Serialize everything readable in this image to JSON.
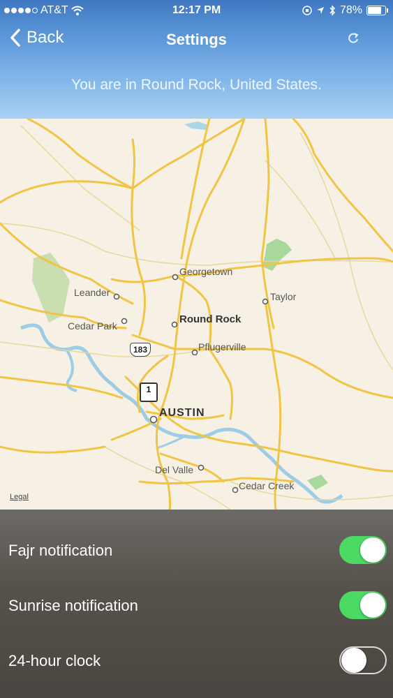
{
  "status_bar": {
    "carrier": "AT&T",
    "time": "12:17 PM",
    "battery": "78%",
    "battery_level": 0.78
  },
  "nav": {
    "back_label": "Back",
    "title": "Settings"
  },
  "location": {
    "text": "You are in Round Rock, United States."
  },
  "map": {
    "cities": {
      "georgetown": "Georgetown",
      "leander": "Leander",
      "taylor": "Taylor",
      "cedar_park": "Cedar Park",
      "round_rock": "Round Rock",
      "pflugerville": "Pflugerville",
      "austin": "AUSTIN",
      "del_valle": "Del Valle",
      "cedar_creek": "Cedar Creek"
    },
    "highway_183": "183",
    "interstate_1": "1",
    "legal": "Legal"
  },
  "settings": [
    {
      "label": "Fajr notification",
      "enabled": true
    },
    {
      "label": "Sunrise notification",
      "enabled": true
    },
    {
      "label": "24-hour clock",
      "enabled": false
    }
  ]
}
